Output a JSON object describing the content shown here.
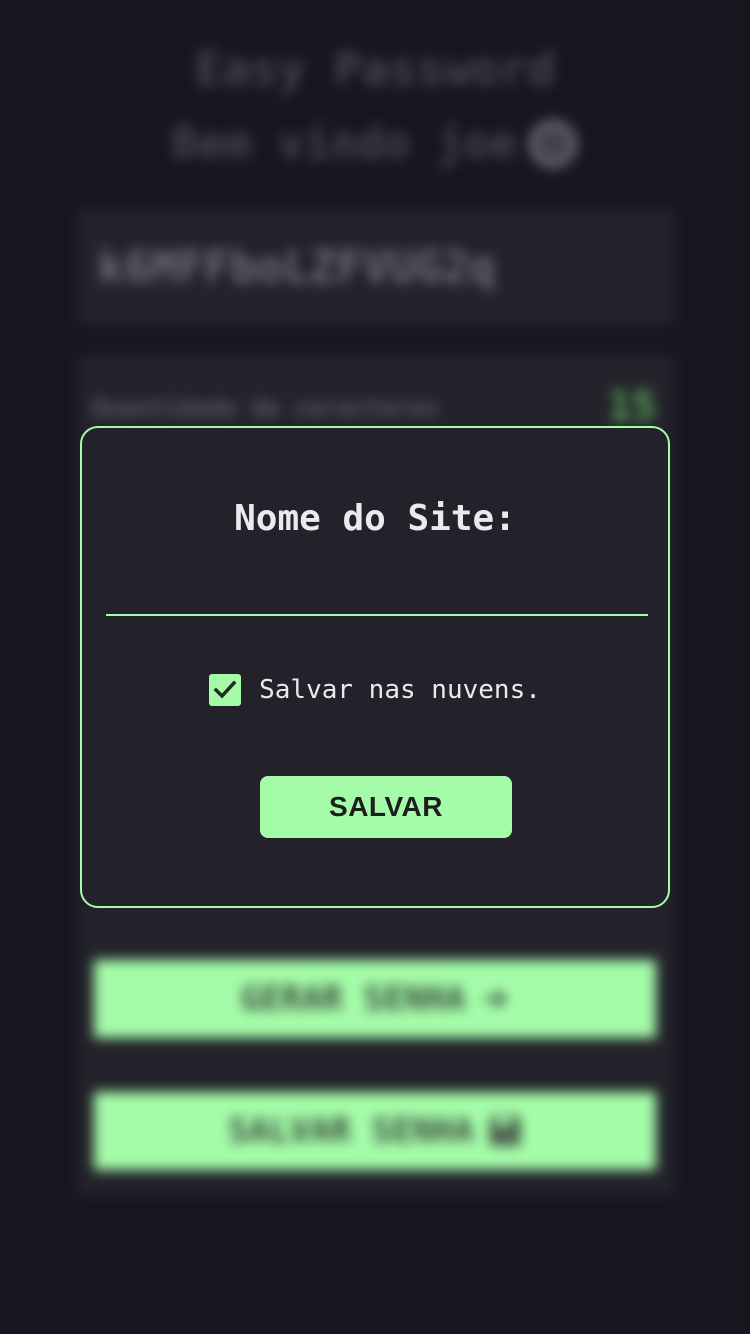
{
  "app": {
    "title": "Easy Password",
    "welcome": "Bem vindo joe"
  },
  "generator": {
    "password": "k6MFFboLZFVUG2q",
    "length_label": "Quantidade de caracteres",
    "length_value": "15",
    "generate_label": "GERAR SENHA",
    "save_label": "SALVAR SENHA"
  },
  "modal": {
    "title": "Nome do Site:",
    "site_input_value": "",
    "save_cloud_label": "Salvar nas nuvens.",
    "save_cloud_checked": true,
    "save_button_label": "SALVAR"
  },
  "colors": {
    "background": "#18171f",
    "panel": "#24232b",
    "accent": "#a4fca9",
    "text": "#e9e9ee"
  },
  "icons": {
    "logout": "logout-icon",
    "arrow": "arrow-right-icon",
    "save": "floppy-disk-icon",
    "check": "check-icon"
  }
}
